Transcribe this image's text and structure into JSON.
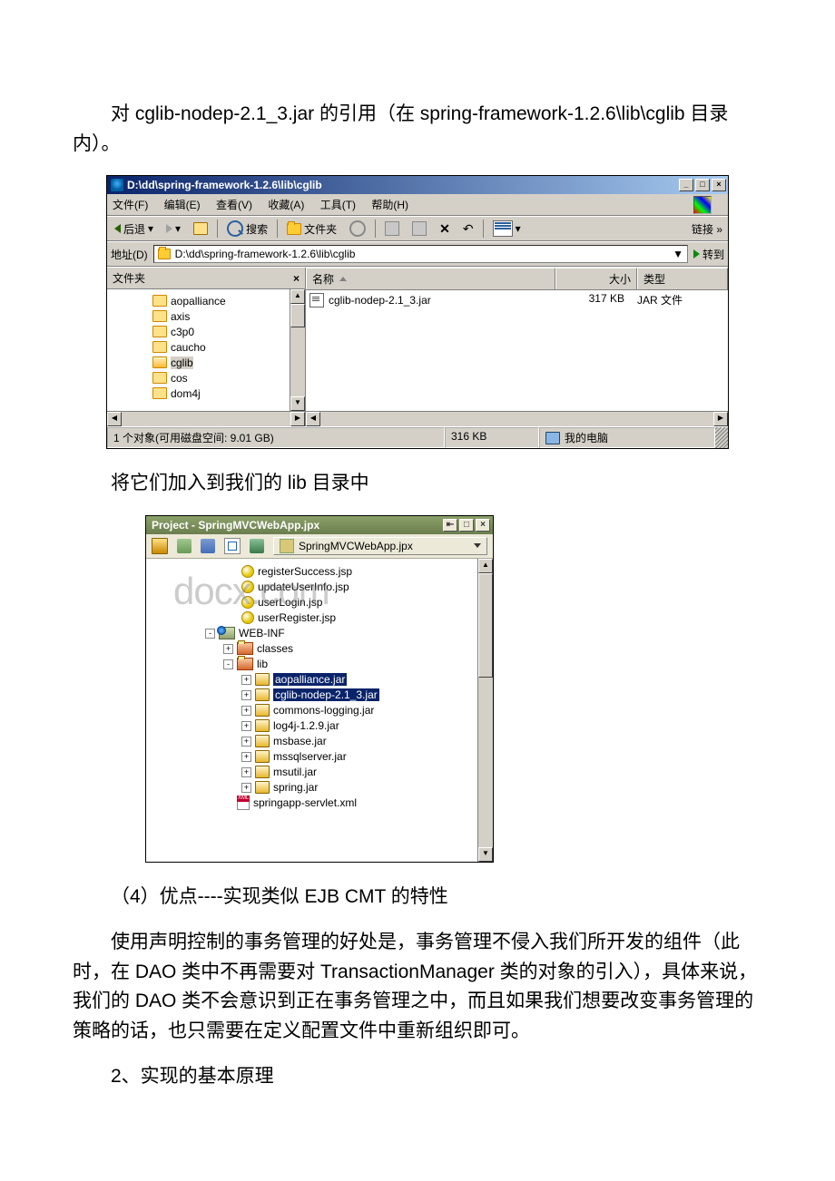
{
  "para1": "对 cglib-nodep-2.1_3.jar 的引用（在 spring-framework-1.2.6\\lib\\cglib 目录内）。",
  "para2": "将它们加入到我们的 lib 目录中",
  "para3": "（4）优点----实现类似 EJB CMT 的特性",
  "para4": "使用声明控制的事务管理的好处是，事务管理不侵入我们所开发的组件（此时，在 DAO 类中不再需要对 TransactionManager 类的对象的引入），具体来说，我们的 DAO 类不会意识到正在事务管理之中，而且如果我们想要改变事务管理的策略的话，也只需要在定义配置文件中重新组织即可。",
  "para5": "2、实现的基本原理",
  "explorer": {
    "title": "D:\\dd\\spring-framework-1.2.6\\lib\\cglib",
    "menus": {
      "file": "文件(F)",
      "edit": "编辑(E)",
      "view": "查看(V)",
      "fav": "收藏(A)",
      "tools": "工具(T)",
      "help": "帮助(H)"
    },
    "toolbar": {
      "back": "后退",
      "search": "搜索",
      "folders": "文件夹",
      "links": "链接"
    },
    "address": {
      "label": "地址(D)",
      "path": "D:\\dd\\spring-framework-1.2.6\\lib\\cglib",
      "go": "转到"
    },
    "folders_pane": {
      "title": "文件夹",
      "items": [
        "aopalliance",
        "axis",
        "c3p0",
        "caucho",
        "cglib",
        "cos",
        "dom4j"
      ]
    },
    "cols": {
      "name": "名称",
      "size": "大小",
      "type": "类型"
    },
    "file": {
      "name": "cglib-nodep-2.1_3.jar",
      "size": "317 KB",
      "type": "JAR 文件"
    },
    "status": {
      "left": "1 个对象(可用磁盘空间: 9.01 GB)",
      "mid": "316 KB",
      "right": "我的电脑"
    }
  },
  "jbuilder": {
    "title": "Project - SpringMVCWebApp.jpx",
    "project": "SpringMVCWebApp.jpx",
    "watermark": "docx.com",
    "tree": {
      "jsps": [
        "registerSuccess.jsp",
        "updateUserInfo.jsp",
        "userLogin.jsp",
        "userRegister.jsp"
      ],
      "webinf": "WEB-INF",
      "classes": "classes",
      "lib": "lib",
      "jars": [
        "aopalliance.jar",
        "cglib-nodep-2.1_3.jar",
        "commons-logging.jar",
        "log4j-1.2.9.jar",
        "msbase.jar",
        "mssqlserver.jar",
        "msutil.jar",
        "spring.jar"
      ],
      "xml": "springapp-servlet.xml"
    }
  }
}
